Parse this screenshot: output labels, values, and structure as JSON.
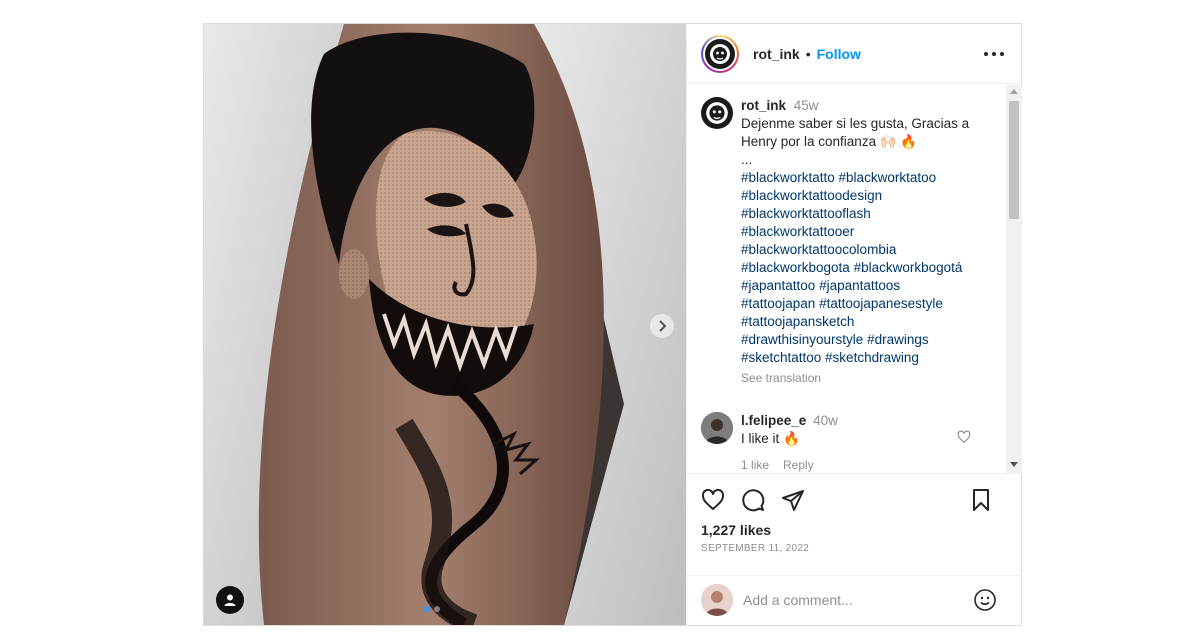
{
  "post": {
    "username": "rot_ink",
    "separator": "•",
    "follow_label": "Follow",
    "caption": {
      "username": "rot_ink",
      "time": "45w",
      "text_line1": "Dejenme saber si les gusta, Gracias a",
      "text_line2": "Henry por la confianza 🙌🏻 🔥",
      "ellipsis": "...",
      "hashtag_lines": [
        "#blackworktatto #blackworktatoo",
        "#blackworktattoodesign",
        "#blackworktattooflash",
        "#blackworktattooer",
        "#blackworktattoocolombia",
        "#blackworkbogota #blackworkbogotá",
        "#japantattoo #japantattoos",
        "#tattoojapan #tattoojapanesestyle",
        "#tattoojapansketch",
        "#drawthisinyourstyle #drawings",
        "#sketchtattoo #sketchdrawing"
      ],
      "see_translation": "See translation"
    },
    "comment": {
      "username": "l.felipee_e",
      "time": "40w",
      "text": "I like it 🔥",
      "likes": "1 like",
      "reply_label": "Reply"
    },
    "likes": "1,227 likes",
    "date": "SEPTEMBER 11, 2022",
    "add_comment_placeholder": "Add a comment..."
  },
  "icons": {
    "like": "heart-icon",
    "comment": "comment-icon",
    "share": "share-icon",
    "save": "bookmark-icon",
    "more": "more-options-icon",
    "next": "chevron-right-icon",
    "tag": "user-tag-icon",
    "emoji": "emoji-icon"
  },
  "colors": {
    "link": "#0095f6",
    "hashtag": "#00376b",
    "secondary_text": "#8e8e8e",
    "carousel_active": "#3897f0"
  }
}
